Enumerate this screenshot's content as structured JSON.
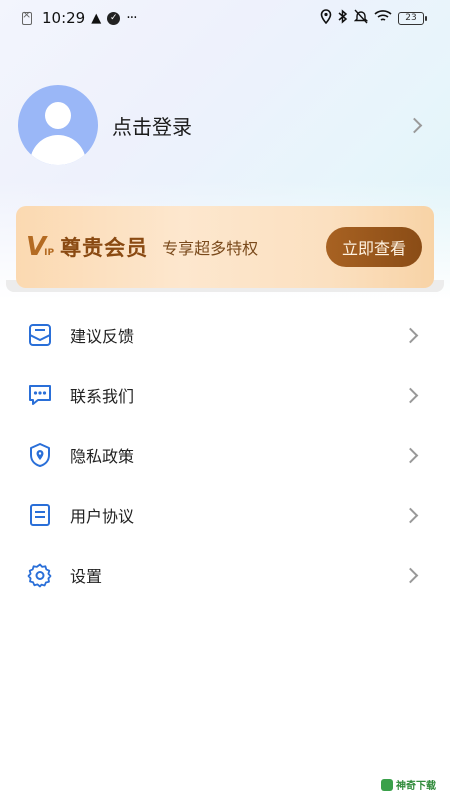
{
  "status_bar": {
    "time": "10:29",
    "battery": "23",
    "icons_left": [
      "sim-off-icon",
      "warning-icon",
      "app-notify-icon",
      "more-dots-icon"
    ],
    "icons_right": [
      "location-icon",
      "bluetooth-icon",
      "mute-icon",
      "wifi-icon",
      "battery-icon"
    ]
  },
  "profile": {
    "login_text": "点击登录"
  },
  "vip": {
    "logo_v": "V",
    "logo_ip": "IP",
    "title": "尊贵会员",
    "subtitle": "专享超多特权",
    "button": "立即查看"
  },
  "menu": {
    "items": [
      {
        "label": "建议反馈",
        "icon": "feedback-icon"
      },
      {
        "label": "联系我们",
        "icon": "chat-icon"
      },
      {
        "label": "隐私政策",
        "icon": "shield-location-icon"
      },
      {
        "label": "用户协议",
        "icon": "document-icon"
      },
      {
        "label": "设置",
        "icon": "gear-icon"
      }
    ]
  },
  "watermark": {
    "text": "神奇下载"
  },
  "colors": {
    "icon_blue": "#2a6fd8",
    "avatar": "#9ab7f7",
    "vip_button": "#8a4c16"
  }
}
